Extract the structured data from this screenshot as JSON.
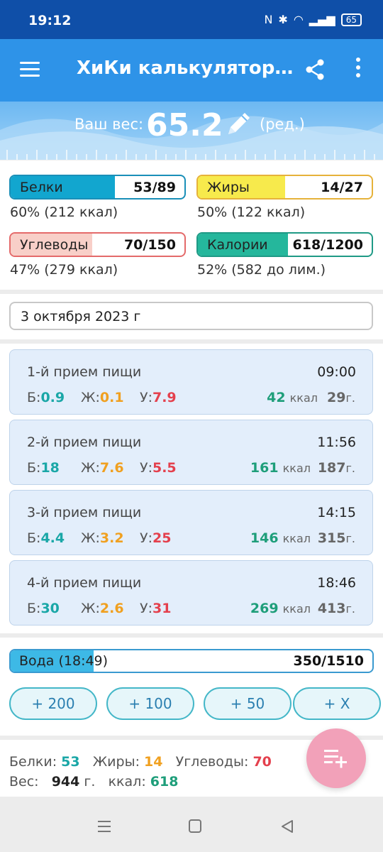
{
  "status_bar": {
    "time": "19:12",
    "battery": "65"
  },
  "app_bar": {
    "title": "ХиКи калькулятор…"
  },
  "weight": {
    "label": "Ваш вес:",
    "value": "65.2",
    "edit_label": "(ред.)"
  },
  "macros": [
    {
      "name": "Белки",
      "value": "53/89",
      "percent_text": "60% (212 ккал)",
      "fill_fraction": 0.6,
      "fill_color": "#12a6cf",
      "border_color": "#1a8fb8"
    },
    {
      "name": "Жиры",
      "value": "14/27",
      "percent_text": "50% (122 ккал)",
      "fill_fraction": 0.5,
      "fill_color": "#f7ea4c",
      "border_color": "#e6b23a"
    },
    {
      "name": "Углеводы",
      "value": "70/150",
      "percent_text": "47% (279 ккал)",
      "fill_fraction": 0.47,
      "fill_color": "#f8cfc8",
      "border_color": "#e46a6a"
    },
    {
      "name": "Калории",
      "value": "618/1200",
      "percent_text": "52% (582 до лим.)",
      "fill_fraction": 0.52,
      "fill_color": "#25b79c",
      "border_color": "#1f9a86"
    }
  ],
  "date": {
    "value": "3 октября 2023 г"
  },
  "meal_labels": {
    "protein": "Б:",
    "fat": "Ж:",
    "carbs": "У:",
    "kcal_unit": "ккал",
    "gram_unit": "г."
  },
  "meals": [
    {
      "name": "1-й прием пищи",
      "time": "09:00",
      "protein": "0.9",
      "fat": "0.1",
      "carbs": "7.9",
      "kcal": "42",
      "grams": "29"
    },
    {
      "name": "2-й прием пищи",
      "time": "11:56",
      "protein": "18",
      "fat": "7.6",
      "carbs": "5.5",
      "kcal": "161",
      "grams": "187"
    },
    {
      "name": "3-й прием пищи",
      "time": "14:15",
      "protein": "4.4",
      "fat": "3.2",
      "carbs": "25",
      "kcal": "146",
      "grams": "315"
    },
    {
      "name": "4-й прием пищи",
      "time": "18:46",
      "protein": "30",
      "fat": "2.6",
      "carbs": "31",
      "kcal": "269",
      "grams": "413"
    }
  ],
  "water": {
    "label": "Вода (18:49)",
    "value": "350/1510",
    "fill_fraction": 0.23,
    "buttons": [
      "+ 200",
      "+ 100",
      "+ 50",
      "+ X"
    ]
  },
  "summary": {
    "protein_label": "Белки:",
    "protein": "53",
    "fat_label": "Жиры:",
    "fat": "14",
    "carbs_label": "Углеводы:",
    "carbs": "70",
    "weight_label": "Вес:",
    "weight": "944",
    "weight_unit": "г.",
    "kcal_label": "ккал:",
    "kcal": "618"
  },
  "icons": [
    "menu-icon",
    "share-icon",
    "more-icon",
    "edit-icon",
    "add-list-icon",
    "nav-recents-icon",
    "nav-home-icon",
    "nav-back-icon"
  ]
}
